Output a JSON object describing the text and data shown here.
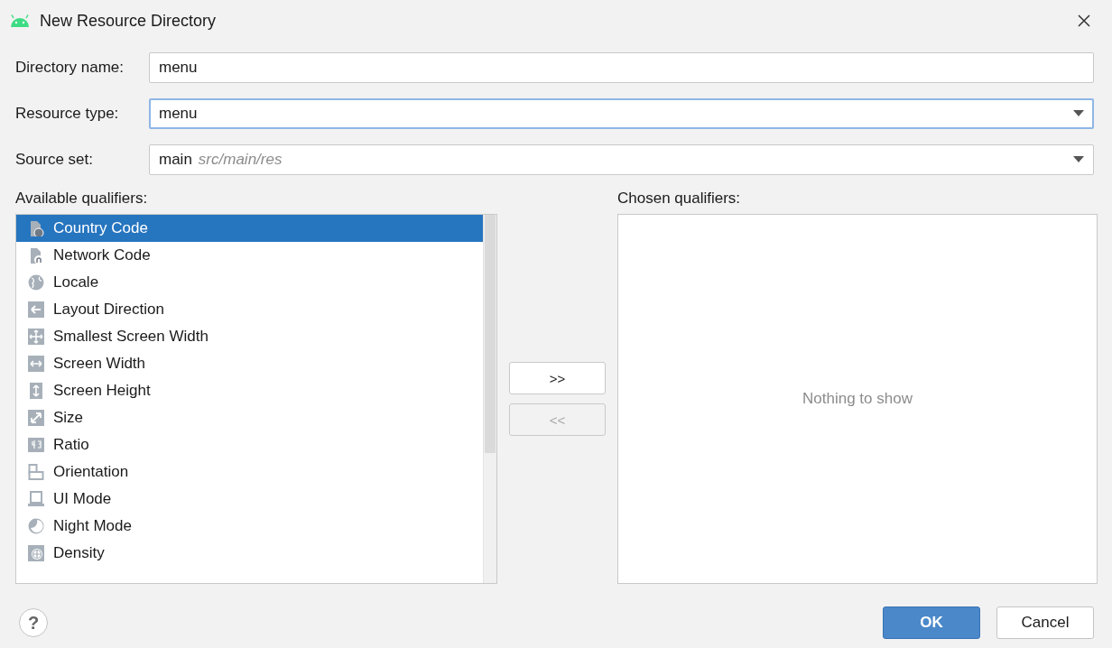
{
  "window": {
    "title": "New Resource Directory"
  },
  "fields": [
    {
      "label": "Directory name:",
      "kind": "text",
      "value": "menu",
      "focused": false
    },
    {
      "label": "Resource type:",
      "kind": "dropdown",
      "value": "menu",
      "focused": true
    },
    {
      "label": "Source set:",
      "kind": "dropdown",
      "value": "main",
      "hint": "src/main/res",
      "focused": false
    }
  ],
  "available_qualifiers": {
    "label": "Available qualifiers:",
    "items": [
      {
        "label": "Country Code",
        "selected": true
      },
      {
        "label": "Network Code",
        "selected": false
      },
      {
        "label": "Locale",
        "selected": false
      },
      {
        "label": "Layout Direction",
        "selected": false
      },
      {
        "label": "Smallest Screen Width",
        "selected": false
      },
      {
        "label": "Screen Width",
        "selected": false
      },
      {
        "label": "Screen Height",
        "selected": false
      },
      {
        "label": "Size",
        "selected": false
      },
      {
        "label": "Ratio",
        "selected": false
      },
      {
        "label": "Orientation",
        "selected": false
      },
      {
        "label": "UI Mode",
        "selected": false
      },
      {
        "label": "Night Mode",
        "selected": false
      },
      {
        "label": "Density",
        "selected": false
      }
    ]
  },
  "move_buttons": [
    {
      "label": ">>",
      "disabled": false
    },
    {
      "label": "<<",
      "disabled": true
    }
  ],
  "chosen_qualifiers": {
    "label": "Chosen qualifiers:",
    "empty_text": "Nothing to show"
  },
  "help_button": "?",
  "buttons": [
    {
      "label": "OK",
      "primary": true
    },
    {
      "label": "Cancel",
      "primary": false
    }
  ]
}
